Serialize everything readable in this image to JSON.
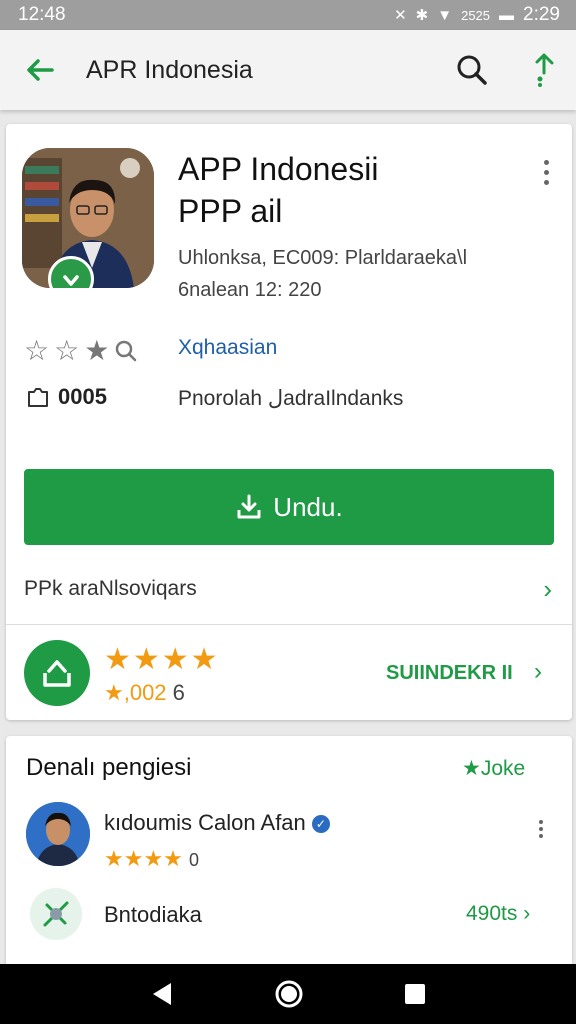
{
  "status_bar": {
    "time_left": "12:48",
    "signal_label": "2525",
    "time_right": "2:29"
  },
  "app_bar": {
    "title": "APR Indonesia",
    "back_icon": "arrow-left-icon",
    "search_icon": "search-icon",
    "share_icon": "share-icon"
  },
  "app": {
    "title_line1": "APP Indonesii",
    "title_line2": "PPP ail",
    "meta_line1": "Uhlonksa, EC009: Plarldaraeka\\l",
    "meta_line2": "6nalean 12: 220",
    "category": "Xqhaasian",
    "size": "0005",
    "developer": "Pnorolah لadraIlndanks",
    "install_label": "Undu.",
    "more_info_label": "PPk araNlsoviqars"
  },
  "promo": {
    "stars": "★★★★",
    "count": "★,002",
    "count_suffix": "6",
    "link_label": "SUIINDEKR II"
  },
  "reviews": {
    "header": "Denalı pengiesi",
    "more_label": "★Joke",
    "review": {
      "name": "kıdoumis Calon Afan",
      "stars": "★★★★",
      "rating_count": "0"
    },
    "item2": {
      "label": "Bntodiaka",
      "value": "490ts"
    }
  },
  "colors": {
    "accent": "#1f9a45",
    "star": "#f29a12",
    "link": "#1f5fa8"
  }
}
